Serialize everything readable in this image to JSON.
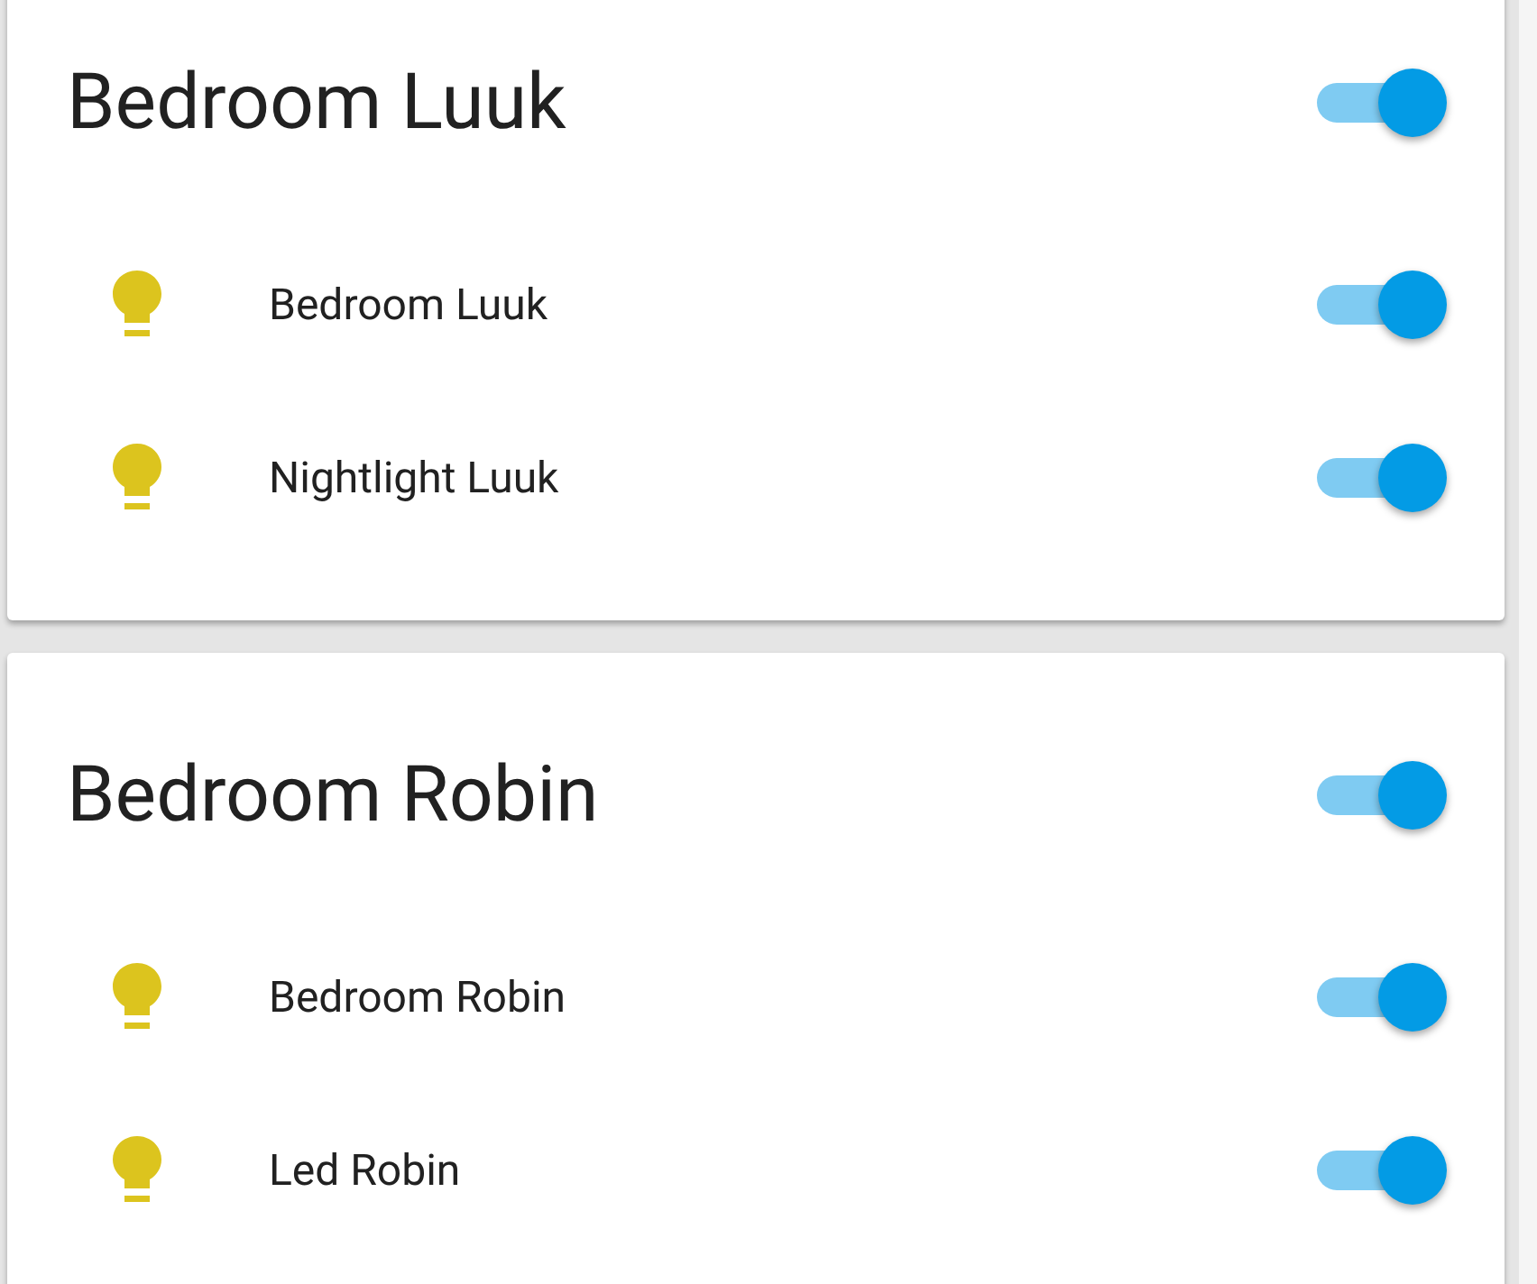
{
  "cards": [
    {
      "title": "Bedroom Luuk",
      "on": true,
      "entities": [
        {
          "name": "Bedroom Luuk",
          "on": true
        },
        {
          "name": "Nightlight Luuk",
          "on": true
        }
      ]
    },
    {
      "title": "Bedroom Robin",
      "on": true,
      "entities": [
        {
          "name": "Bedroom Robin",
          "on": true
        },
        {
          "name": "Led Robin",
          "on": true
        }
      ]
    }
  ]
}
